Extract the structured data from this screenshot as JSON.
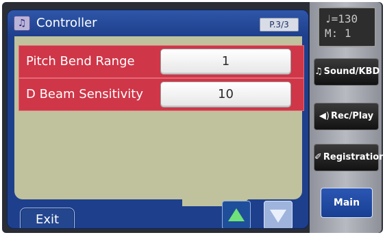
{
  "header": {
    "icon": "music-note-icon",
    "title": "Controller",
    "page_indicator": "P.3/3"
  },
  "settings": [
    {
      "label": "Pitch Bend Range",
      "value": "1"
    },
    {
      "label": "D Beam Sensitivity",
      "value": "10"
    }
  ],
  "footer": {
    "exit_label": "Exit",
    "up_icon": "arrow-up-icon",
    "down_icon": "arrow-down-icon"
  },
  "tempo": {
    "line1": "♩=130",
    "line2": "M:   1"
  },
  "side_menu": {
    "sound_kbd": {
      "icon": "music-note-icon",
      "label": "Sound/KBD"
    },
    "rec_play": {
      "icon": "speaker-icon",
      "label": "Rec/Play"
    },
    "registration": {
      "icon": "registration-book-icon",
      "label": "Registration"
    },
    "main": {
      "label": "Main"
    }
  },
  "colors": {
    "panel_blue": "#1e3f8c",
    "content_olive": "#bfc29d",
    "row_red": "#cf3648",
    "up_arrow_green": "#6fe27a"
  }
}
